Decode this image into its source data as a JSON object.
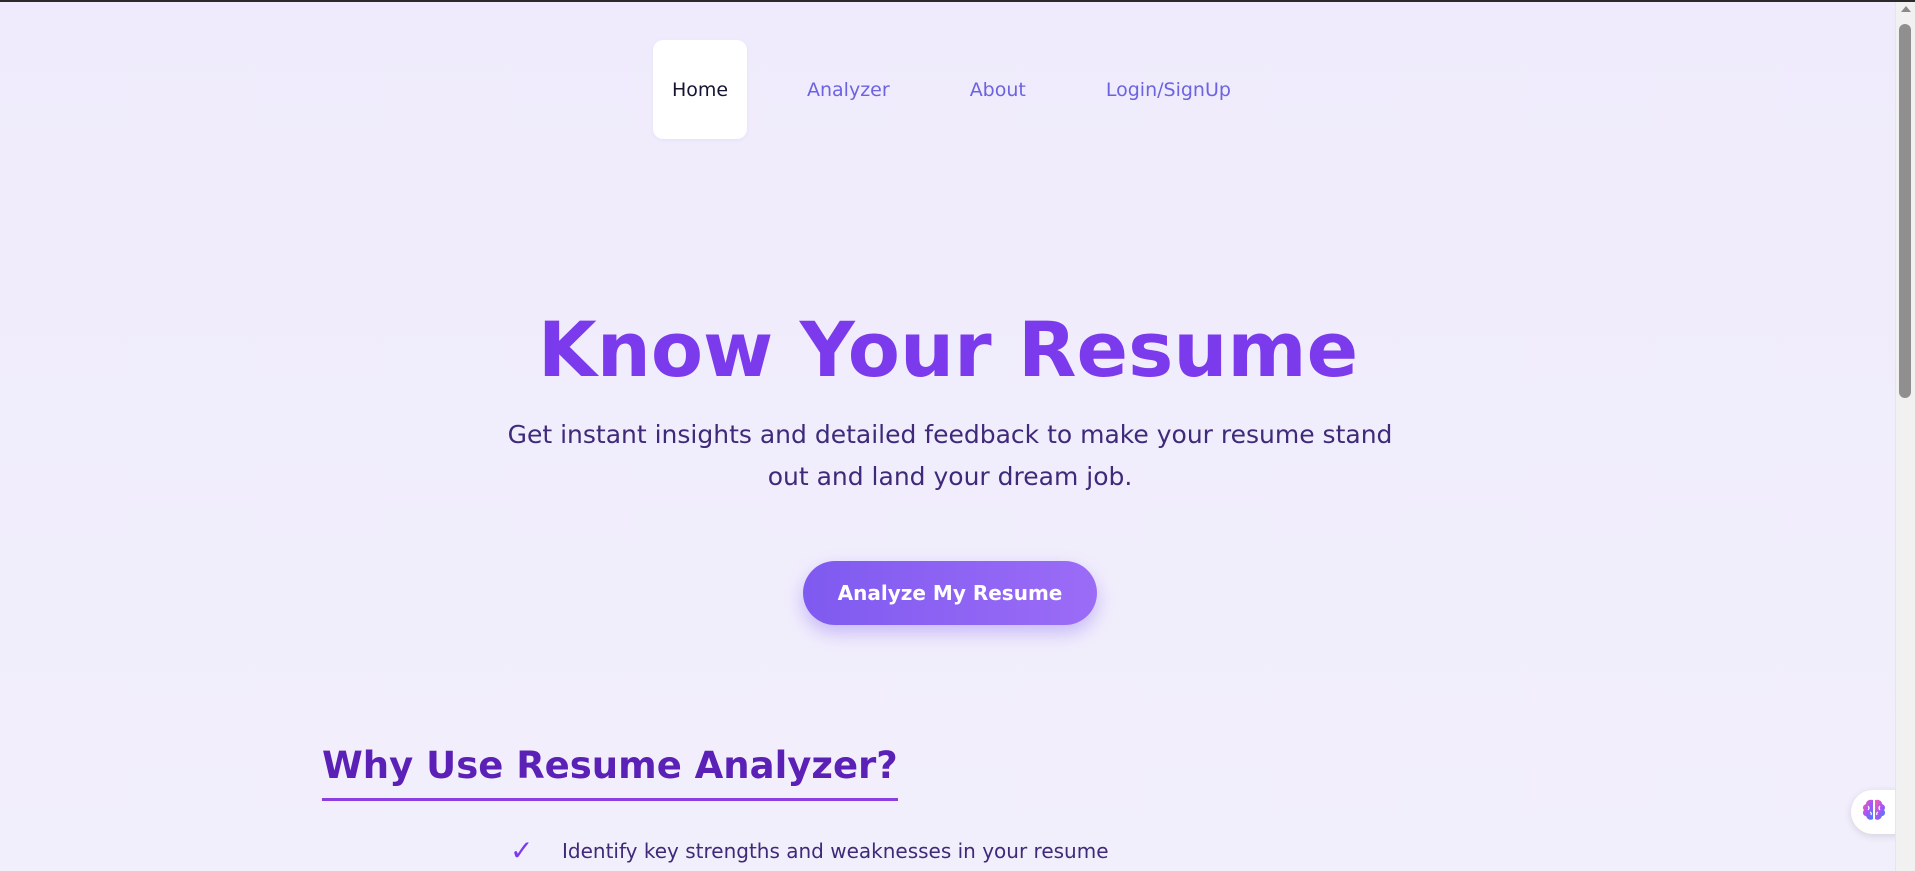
{
  "nav": {
    "items": [
      {
        "label": "Home",
        "active": true
      },
      {
        "label": "Analyzer",
        "active": false
      },
      {
        "label": "About",
        "active": false
      },
      {
        "label": "Login/SignUp",
        "active": false
      }
    ]
  },
  "hero": {
    "title": "Know Your Resume",
    "subtitle": "Get instant insights and detailed feedback to make your resume stand out and land your dream job.",
    "cta_label": "Analyze My Resume"
  },
  "why": {
    "title": "Why Use Resume Analyzer?",
    "items": [
      {
        "icon": "✓",
        "text": "Identify key strengths and weaknesses in your resume"
      }
    ]
  },
  "widget": {
    "icon": "brain-icon"
  },
  "colors": {
    "accent": "#7c3aed",
    "nav_link": "#6b63e0",
    "heading_dark": "#5b21b6",
    "body_text": "#3f2a7a",
    "background": "#efecfc"
  }
}
